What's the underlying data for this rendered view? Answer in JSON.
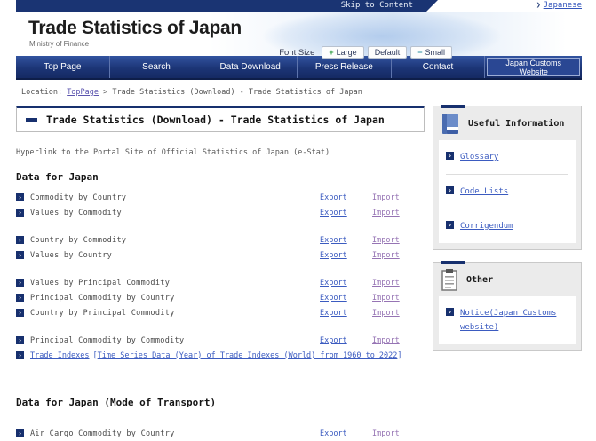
{
  "top_bar": {
    "skip_link": "Skip to Content",
    "language_link": "Japanese"
  },
  "header": {
    "title": "Trade Statistics of Japan",
    "subtitle": "Ministry of Finance",
    "font_size": {
      "label": "Font Size",
      "large_sign": "+",
      "large_word": "Large",
      "default_word": "Default",
      "small_sign": "−",
      "small_word": "Small"
    }
  },
  "nav": {
    "items": [
      {
        "label": "Top Page"
      },
      {
        "label": "Search"
      },
      {
        "label": "Data Download"
      },
      {
        "label": "Press Release"
      },
      {
        "label": "Contact"
      },
      {
        "label": "Japan Customs Website"
      }
    ]
  },
  "breadcrumb": {
    "prefix": "Location:",
    "home": "TopPage",
    "separator": ">",
    "current": "Trade Statistics (Download) - Trade Statistics of Japan"
  },
  "main": {
    "page_heading": "Trade Statistics (Download) - Trade Statistics of Japan",
    "intro": "Hyperlink to the Portal Site of Official Statistics of Japan (e-Stat)",
    "link_labels": {
      "export": "Export",
      "import": "Import"
    },
    "section1": {
      "heading": "Data for Japan",
      "groups": [
        {
          "rows": [
            {
              "label": "Commodity by Country"
            },
            {
              "label": "Values by Commodity"
            }
          ]
        },
        {
          "rows": [
            {
              "label": "Country by Commodity"
            },
            {
              "label": "Values by Country"
            }
          ]
        },
        {
          "rows": [
            {
              "label": "Values by Principal Commodity"
            },
            {
              "label": "Principal Commodity by Country"
            },
            {
              "label": "Country by Principal Commodity"
            }
          ]
        },
        {
          "rows": [
            {
              "label": "Principal Commodity by Commodity"
            }
          ]
        }
      ],
      "trade_indexes": {
        "link1": "Trade Indexes",
        "bracket_open": "[",
        "link2": "Time Series Data (Year) of Trade Indexes (World) from 1960 to 2022",
        "bracket_close": "]"
      }
    },
    "section2": {
      "heading": "Data for Japan (Mode of Transport)",
      "groups": [
        {
          "rows": [
            {
              "label": "Air Cargo Commodity by Country"
            }
          ]
        }
      ]
    }
  },
  "sidebar": {
    "useful": {
      "title": "Useful Information",
      "items": [
        {
          "label": "Glossary"
        },
        {
          "label": "Code Lists"
        },
        {
          "label": "Corrigendum"
        }
      ]
    },
    "other": {
      "title": "Other",
      "items": [
        {
          "label": "Notice(Japan Customs website)"
        }
      ]
    }
  },
  "colors": {
    "navy": "#17306e",
    "nav_gradient_top": "#32539f",
    "nav_gradient_bottom": "#152a63",
    "link_blue": "#3b5bc0",
    "visited_purple": "#9674b4",
    "body_text": "#4a4a4a",
    "box_bg": "#ebebeb"
  }
}
